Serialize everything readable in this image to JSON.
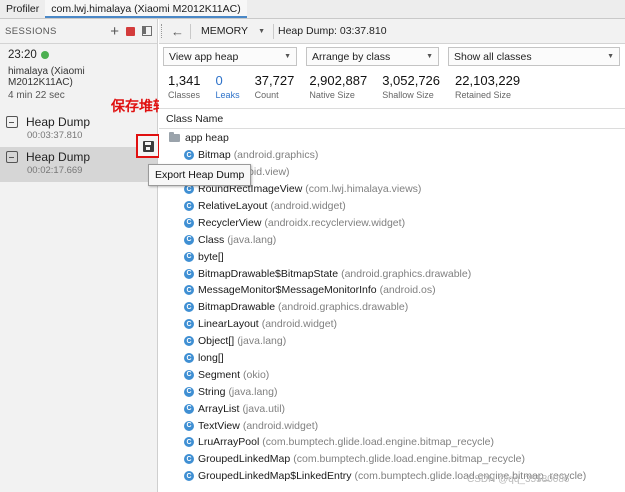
{
  "tabs": [
    "Profiler",
    "com.lwj.himalaya (Xiaomi M2012K11AC)"
  ],
  "sessions": {
    "header": "SESSIONS",
    "time": "23:20",
    "device": "himalaya (Xiaomi M2012K11AC)",
    "duration": "4 min 22 sec",
    "dumps": [
      {
        "label": "Heap Dump",
        "time": "00:03:37.810"
      },
      {
        "label": "Heap Dump",
        "time": "00:02:17.669"
      }
    ]
  },
  "annotation": "保存堆转储",
  "tooltip": "Export Heap Dump",
  "toolbar": {
    "back_icon": "back-arrow-icon",
    "memory_label": "MEMORY",
    "heap_title": "Heap Dump: 03:37.810"
  },
  "filters": {
    "view": "View app heap",
    "arrange": "Arrange by class",
    "show": "Show all classes"
  },
  "stats": [
    {
      "value": "1,341",
      "label": "Classes"
    },
    {
      "value": "0",
      "label": "Leaks"
    },
    {
      "value": "37,727",
      "label": "Count"
    },
    {
      "value": "2,902,887",
      "label": "Native Size"
    },
    {
      "value": "3,052,726",
      "label": "Shallow Size"
    },
    {
      "value": "22,103,229",
      "label": "Retained Size"
    }
  ],
  "column_header": "Class Name",
  "tree_root": "app heap",
  "classes": [
    {
      "name": "Bitmap",
      "pkg": "(android.graphics)"
    },
    {
      "name": "View",
      "pkg": "(android.view)"
    },
    {
      "name": "RoundRectImageView",
      "pkg": "(com.lwj.himalaya.views)"
    },
    {
      "name": "RelativeLayout",
      "pkg": "(android.widget)"
    },
    {
      "name": "RecyclerView",
      "pkg": "(androidx.recyclerview.widget)"
    },
    {
      "name": "Class",
      "pkg": "(java.lang)"
    },
    {
      "name": "byte[]",
      "pkg": ""
    },
    {
      "name": "BitmapDrawable$BitmapState",
      "pkg": "(android.graphics.drawable)"
    },
    {
      "name": "MessageMonitor$MessageMonitorInfo",
      "pkg": "(android.os)"
    },
    {
      "name": "BitmapDrawable",
      "pkg": "(android.graphics.drawable)"
    },
    {
      "name": "LinearLayout",
      "pkg": "(android.widget)"
    },
    {
      "name": "Object[]",
      "pkg": "(java.lang)"
    },
    {
      "name": "long[]",
      "pkg": ""
    },
    {
      "name": "Segment",
      "pkg": "(okio)"
    },
    {
      "name": "String",
      "pkg": "(java.lang)"
    },
    {
      "name": "ArrayList",
      "pkg": "(java.util)"
    },
    {
      "name": "TextView",
      "pkg": "(android.widget)"
    },
    {
      "name": "LruArrayPool",
      "pkg": "(com.bumptech.glide.load.engine.bitmap_recycle)"
    },
    {
      "name": "GroupedLinkedMap",
      "pkg": "(com.bumptech.glide.load.engine.bitmap_recycle)"
    },
    {
      "name": "GroupedLinkedMap$LinkedEntry",
      "pkg": "(com.bumptech.glide.load.engine.bitmap_recycle)"
    }
  ],
  "watermark": "CSDN @qq_35580086",
  "colors": {
    "accent": "#2e72c9",
    "highlight": "#e01010",
    "class_icon": "#3f8fd3",
    "live": "#4caf50"
  }
}
